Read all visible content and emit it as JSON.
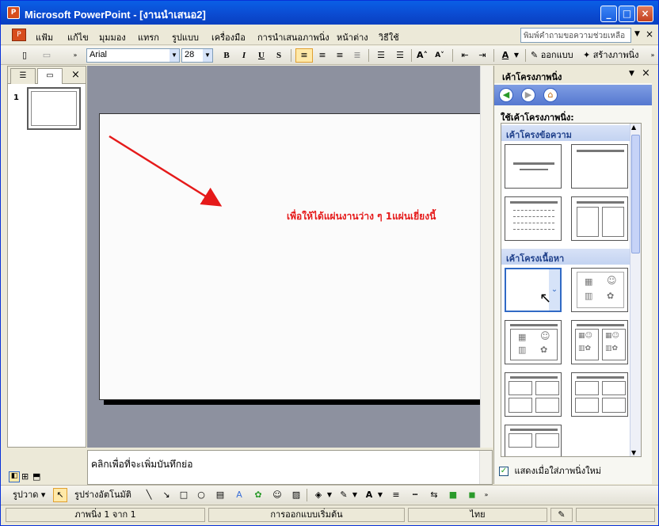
{
  "window": {
    "title": "Microsoft PowerPoint - [งานนำเสนอ2]",
    "app_icon": "powerpoint-icon",
    "controls": [
      "minimize-icon",
      "maximize-icon",
      "close-icon"
    ]
  },
  "menu": {
    "items": [
      "แฟ้ม",
      "แก้ไข",
      "มุมมอง",
      "แทรก",
      "รูปแบบ",
      "เครื่องมือ",
      "การนำเสนอภาพนิ่ง",
      "หน้าต่าง",
      "วิธีใช้"
    ],
    "help_placeholder": "พิมพ์คำถามขอความช่วยเหลือ"
  },
  "format_toolbar": {
    "font": "Arial",
    "size": "28",
    "bold": "B",
    "italic": "I",
    "underline": "U",
    "shadow": "S",
    "design_label": "ออกแบบ",
    "new_slide_label": "สร้างภาพนิ่ง"
  },
  "left_pane": {
    "tabs": [
      "outline-tab",
      "slides-tab"
    ],
    "slide_number": "1"
  },
  "slide": {
    "annotation": "เพื่อให้ได้แผ่นงานว่าง ๆ 1แผ่นเยี่ยงนี้",
    "annotation_color": "#e51a1a"
  },
  "notes": {
    "placeholder": "คลิกเพื่อที่จะเพิ่มบันทึกย่อ"
  },
  "draw_toolbar": {
    "draw_label": "รูปวาด",
    "autoshapes_label": "รูปร่างอัตโนมัติ"
  },
  "status": {
    "slide_info": "ภาพนิ่ง 1 จาก 1",
    "design": "การออกแบบเริ่มต้น",
    "language": "ไทย"
  },
  "task_pane": {
    "title": "เค้าโครงภาพนิ่ง",
    "apply_label": "ใช้เค้าโครงภาพนิ่ง:",
    "section_text": "เค้าโครงข้อความ",
    "section_content": "เค้าโครงเนื้อหา",
    "show_when_inserting": "แสดงเมื่อใส่ภาพนิ่งใหม่",
    "accent_color": "#316ac5"
  }
}
